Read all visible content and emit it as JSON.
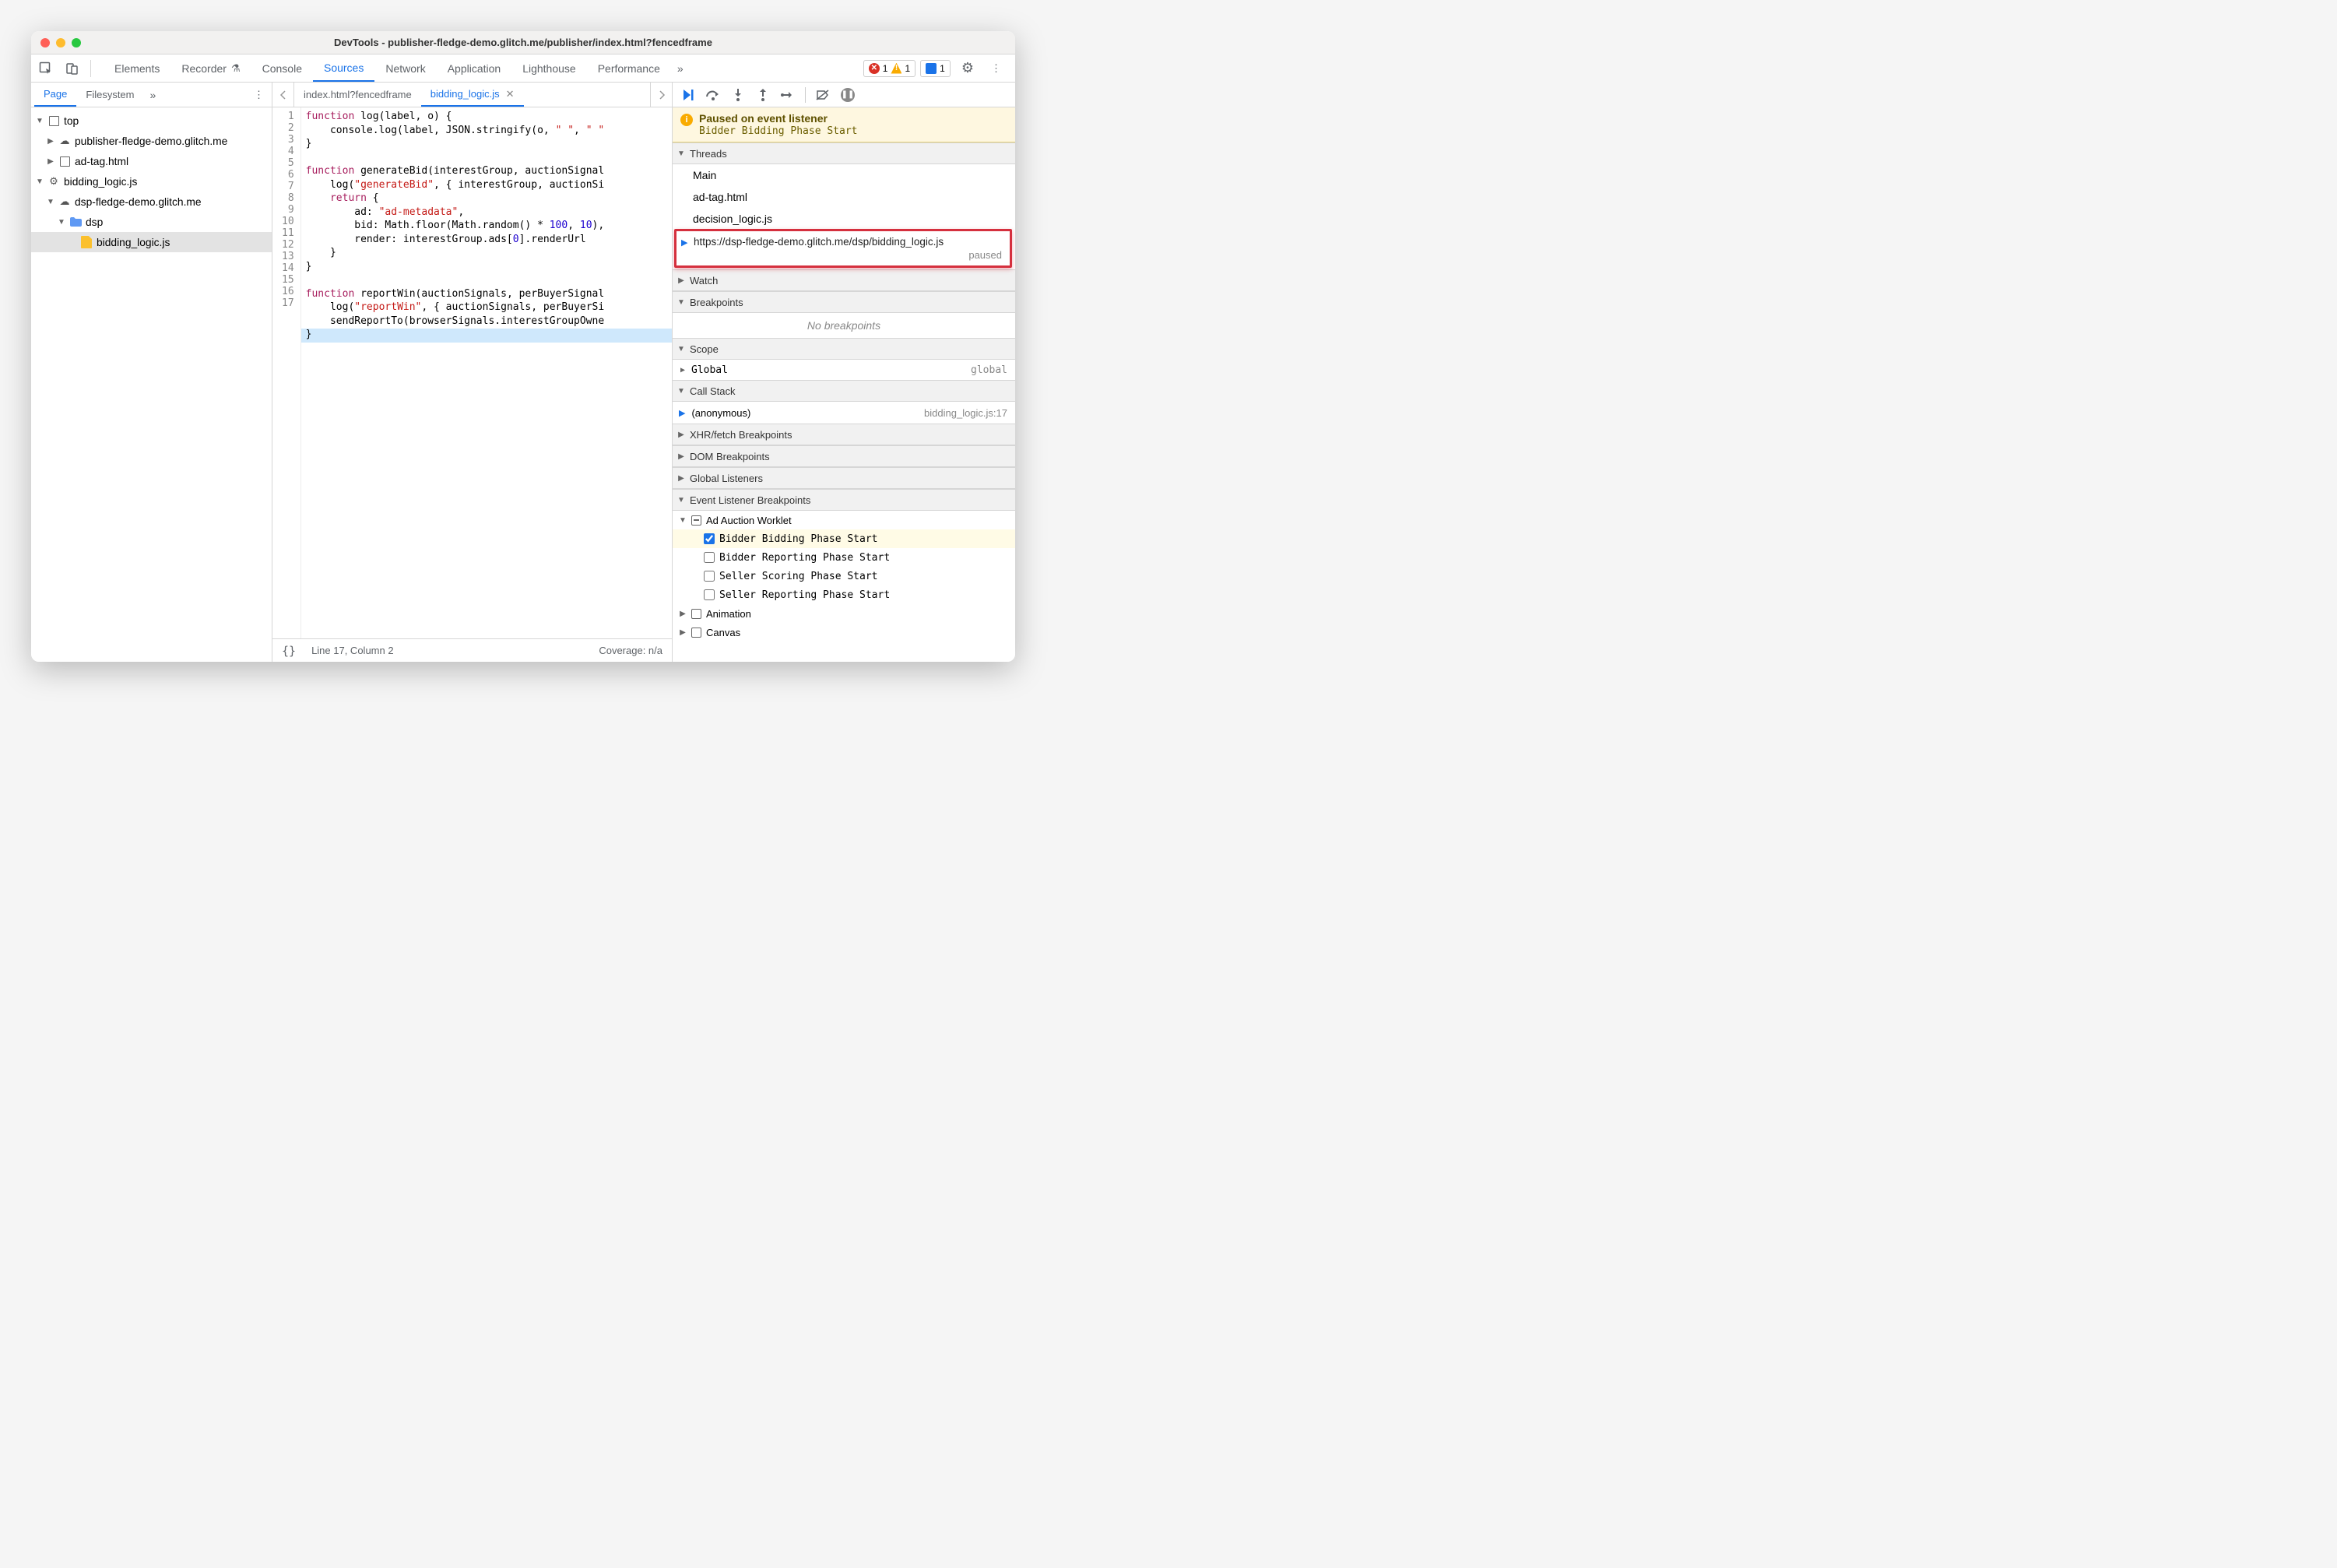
{
  "window_title": "DevTools - publisher-fledge-demo.glitch.me/publisher/index.html?fencedframe",
  "main_tabs": [
    "Elements",
    "Recorder",
    "Console",
    "Sources",
    "Network",
    "Application",
    "Lighthouse",
    "Performance"
  ],
  "main_active_tab": "Sources",
  "error_count": "1",
  "warning_count": "1",
  "issue_count": "1",
  "left": {
    "tabs": [
      "Page",
      "Filesystem"
    ],
    "active": "Page",
    "tree": {
      "top": "top",
      "pub_domain": "publisher-fledge-demo.glitch.me",
      "ad_tag": "ad-tag.html",
      "bidding_worker": "bidding_logic.js",
      "dsp_domain": "dsp-fledge-demo.glitch.me",
      "dsp_folder": "dsp",
      "bidding_file": "bidding_logic.js"
    }
  },
  "center": {
    "file_tabs": [
      "index.html?fencedframe",
      "bidding_logic.js"
    ],
    "active_file": "bidding_logic.js",
    "code_lines": [
      "function log(label, o) {",
      "    console.log(label, JSON.stringify(o, \" \", \" \"",
      "}",
      "",
      "function generateBid(interestGroup, auctionSignal",
      "    log(\"generateBid\", { interestGroup, auctionSi",
      "    return {",
      "        ad: \"ad-metadata\",",
      "        bid: Math.floor(Math.random() * 100, 10),",
      "        render: interestGroup.ads[0].renderUrl",
      "    }",
      "}",
      "",
      "function reportWin(auctionSignals, perBuyerSignal",
      "    log(\"reportWin\", { auctionSignals, perBuyerSi",
      "    sendReportTo(browserSignals.interestGroupOwne",
      "}"
    ],
    "cursor": "Line 17, Column 2",
    "coverage": "Coverage: n/a"
  },
  "right": {
    "pause_title": "Paused on event listener",
    "pause_sub": "Bidder Bidding Phase Start",
    "sections": {
      "threads": "Threads",
      "watch": "Watch",
      "breakpoints": "Breakpoints",
      "scope": "Scope",
      "callstack": "Call Stack",
      "xhr": "XHR/fetch Breakpoints",
      "dom": "DOM Breakpoints",
      "global": "Global Listeners",
      "elb": "Event Listener Breakpoints"
    },
    "threads": {
      "items": [
        "Main",
        "ad-tag.html",
        "decision_logic.js"
      ],
      "active_url": "https://dsp-fledge-demo.glitch.me/dsp/bidding_logic.js",
      "active_state": "paused"
    },
    "no_breakpoints": "No breakpoints",
    "scope_global": "Global",
    "scope_global_val": "global",
    "stack_name": "(anonymous)",
    "stack_loc": "bidding_logic.js:17",
    "elb_cat": {
      "ad_auction": "Ad Auction Worklet",
      "animation": "Animation",
      "canvas": "Canvas"
    },
    "elb_items": [
      "Bidder Bidding Phase Start",
      "Bidder Reporting Phase Start",
      "Seller Scoring Phase Start",
      "Seller Reporting Phase Start"
    ]
  }
}
